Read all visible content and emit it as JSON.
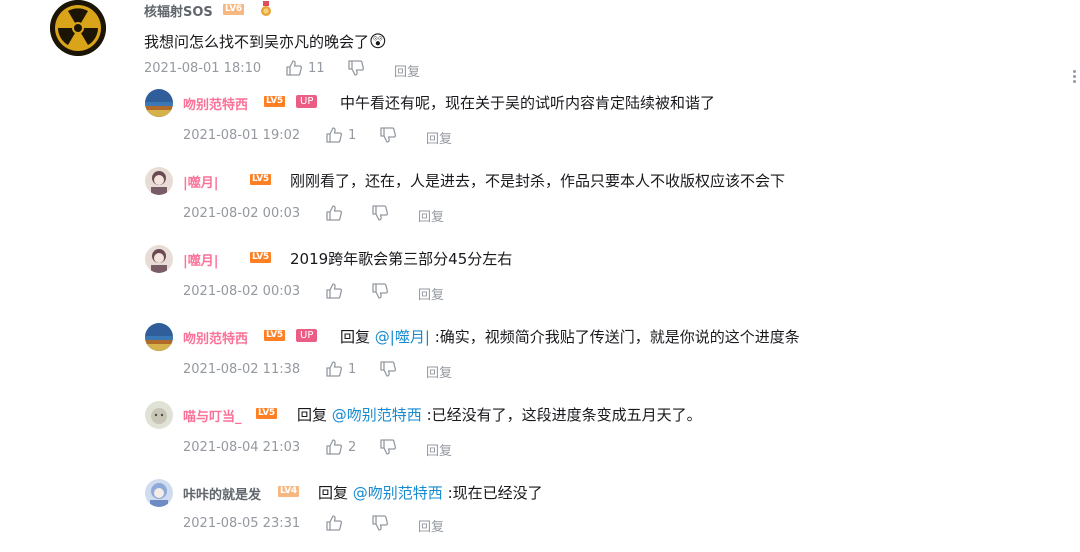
{
  "main_comment": {
    "username": "核辐射SOS",
    "level": "LV6",
    "text": "我想问怎么找不到吴亦凡的晚会了",
    "emoji": "😲",
    "time": "2021-08-01 18:10",
    "likes": "11",
    "reply_label": "回复",
    "colors": {
      "username": "#61666d",
      "level_bg": "#f7b780"
    }
  },
  "replies": [
    {
      "username": "吻别范特西",
      "level": "LV5",
      "up": "UP",
      "text": "中午看还有呢，现在关于吴的试听内容肯定陆续被和谐了",
      "time": "2021-08-01 19:02",
      "likes": "1",
      "reply_label": "回复"
    },
    {
      "username": "|噬月|",
      "level": "LV5",
      "text": "刚刚看了，还在，人是进去，不是封杀，作品只要本人不收版权应该不会下",
      "time": "2021-08-02 00:03",
      "likes": "",
      "reply_label": "回复"
    },
    {
      "username": "|噬月|",
      "level": "LV5",
      "text": "2019跨年歌会第三部分45分左右",
      "time": "2021-08-02 00:03",
      "likes": "",
      "reply_label": "回复"
    },
    {
      "username": "吻别范特西",
      "level": "LV5",
      "up": "UP",
      "reply_word": "回复",
      "mention": "@|噬月|",
      "text": ":确实，视频简介我贴了传送门，就是你说的这个进度条",
      "time": "2021-08-02 11:38",
      "likes": "1",
      "reply_label": "回复"
    },
    {
      "username": "喵与叮当_",
      "level": "LV5",
      "reply_word": "回复",
      "mention": "@吻别范特西",
      "text": ":已经没有了，这段进度条变成五月天了。",
      "time": "2021-08-04 21:03",
      "likes": "2",
      "reply_label": "回复"
    },
    {
      "username": "咔咔的就是发",
      "level": "LV4",
      "reply_word": "回复",
      "mention": "@吻别范特西",
      "text": ":现在已经没了",
      "time": "2021-08-05 23:31",
      "likes": "",
      "reply_label": "回复"
    }
  ],
  "icons": {
    "like": "thumbs-up-icon",
    "dislike": "thumbs-down-icon",
    "more": "more-vertical-icon",
    "medal": "medal-icon"
  },
  "colors": {
    "pink_name": "#fb7299",
    "level_orange": "#ff7f24",
    "level_light": "#f7b780",
    "mention": "#178bcf",
    "meta": "#9499a0"
  }
}
